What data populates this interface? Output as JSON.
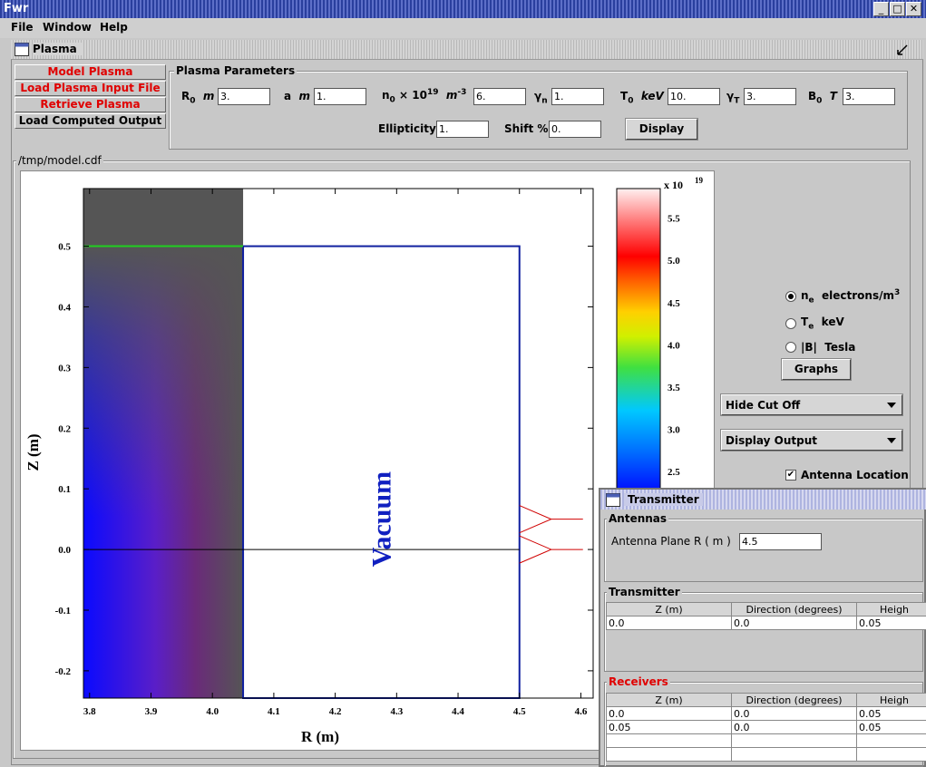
{
  "window": {
    "title": "Fwr",
    "min": "_",
    "max": "□",
    "close": "✕"
  },
  "menu": [
    "File",
    "Window",
    "Help"
  ],
  "plasma_frame": {
    "title": "Plasma"
  },
  "tabs": [
    "Model Plasma",
    "Load Plasma Input File",
    "Retrieve Plasma",
    "Load Computed Output"
  ],
  "params": {
    "group_title": "Plasma Parameters",
    "R0_label": "R",
    "R0_sub": "0",
    "R0_unit": "m",
    "R0": "3.",
    "a_label": "a",
    "a_unit": "m",
    "a": "1.",
    "n0_label": "n",
    "n0_sub": "0",
    "n0_x": "× 10",
    "n0_exp": "19",
    "n0_unit": "m",
    "n0_unit_exp": "-3",
    "n0": "6.",
    "gn_label": "γ",
    "gn_sub": "n",
    "gn": "1.",
    "T0_label": "T",
    "T0_sub": "0",
    "T0_unit": "keV",
    "T0": "10.",
    "gT_label": "γ",
    "gT_sub": "T",
    "gT": "3.",
    "B0_label": "B",
    "B0_sub": "0",
    "B0_unit": "T",
    "B0": "3.",
    "ellipticity_label": "Ellipticity",
    "ellipticity": "1.",
    "shift_label": "Shift %",
    "shift": "0.",
    "display_button": "Display"
  },
  "plot_group_title": "/tmp/model.cdf",
  "chart_data": {
    "type": "heatmap",
    "xlabel": "R (m)",
    "ylabel": "Z (m)",
    "xlim": [
      3.79,
      4.62
    ],
    "ylim": [
      -0.245,
      0.595
    ],
    "xticks": [
      "3.8",
      "3.9",
      "4.0",
      "4.1",
      "4.2",
      "4.3",
      "4.4",
      "4.5",
      "4.6"
    ],
    "yticks": [
      "-0.2",
      "-0.1",
      "0.0",
      "0.1",
      "0.2",
      "0.3",
      "0.4",
      "0.5"
    ],
    "plasma_edge_R": 4.05,
    "vacuum_box": {
      "R": [
        4.05,
        4.5
      ],
      "Z": [
        -0.245,
        0.5
      ]
    },
    "antenna_R": 4.5,
    "region_label": "Vacuum",
    "colorbar": {
      "multiplier": "x 10",
      "multiplier_exp": "19",
      "ticks": [
        "2.5",
        "3.0",
        "3.5",
        "4.0",
        "4.5",
        "5.0",
        "5.5"
      ]
    }
  },
  "side_panel": {
    "radios": [
      {
        "label": "n",
        "sub": "e",
        "unit": "electrons/m",
        "sup": "3",
        "selected": true
      },
      {
        "label": "T",
        "sub": "e",
        "unit": "keV",
        "sup": "",
        "selected": false
      },
      {
        "label": "|B|",
        "sub": "",
        "unit": "Tesla",
        "sup": "",
        "selected": false
      }
    ],
    "graphs_button": "Graphs",
    "cutoff_select": "Hide Cut Off",
    "output_select": "Display Output",
    "antenna_check": "Antenna Location",
    "antenna_checked": "✔"
  },
  "transmitter": {
    "title": "Transmitter",
    "antennas_title": "Antennas",
    "antenna_plane_label": "Antenna Plane  R ( m )",
    "antenna_plane": "4.5",
    "transmitter_title": "Transmitter",
    "columns": [
      "Z (m)",
      "Direction (degrees)",
      "Heigh"
    ],
    "transmitter_rows": [
      [
        "0.0",
        "0.0",
        "0.05"
      ]
    ],
    "receivers_title": "Receivers",
    "receiver_rows": [
      [
        "0.0",
        "0.0",
        "0.05"
      ],
      [
        "0.05",
        "0.0",
        "0.05"
      ]
    ]
  }
}
